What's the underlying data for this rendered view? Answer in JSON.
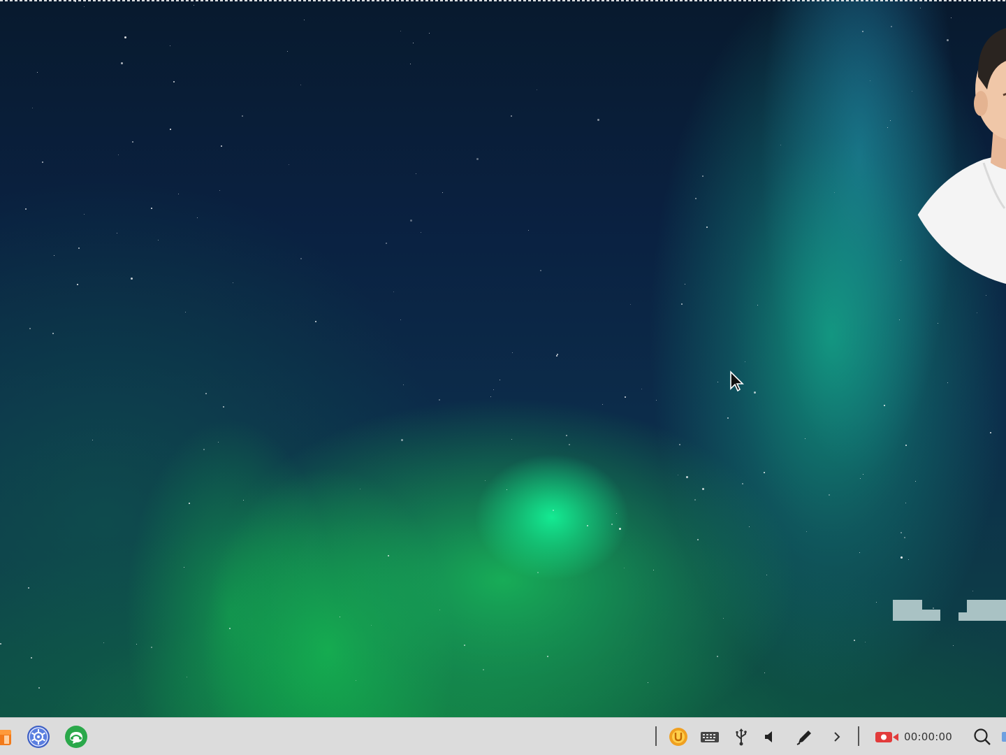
{
  "desktop": {
    "wallpaper": "aurora-night-sky"
  },
  "taskbar": {
    "apps": [
      {
        "name": "files-app-icon"
      },
      {
        "name": "settings-app-icon"
      },
      {
        "name": "chat-app-icon"
      }
    ],
    "tray": {
      "icons": [
        "u-app-icon",
        "keyboard-icon",
        "usb-icon",
        "volume-icon",
        "pen-icon",
        "chevron-right-icon"
      ],
      "recording_time": "00:00:00"
    }
  },
  "colors": {
    "taskbar_bg": "#dcdcdc",
    "record_red": "#e23b3b",
    "tray_orange": "#f0a020",
    "settings_blue": "#3d5fc4",
    "chat_green": "#2aa84a"
  }
}
